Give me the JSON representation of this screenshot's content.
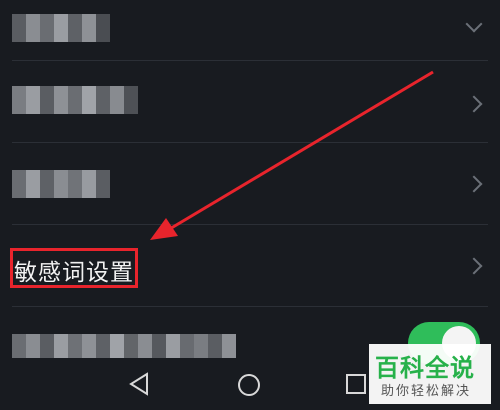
{
  "settings": {
    "highlighted_item_label": "敏感词设置",
    "toggle_on": true
  },
  "navigation": {
    "back_icon": "triangle-back-icon",
    "home_icon": "circle-home-icon",
    "recents_icon": "square-recents-icon"
  },
  "watermark": {
    "title": "百科全说",
    "subtitle": "助你轻松解决"
  },
  "colors": {
    "background": "#181b20",
    "highlight": "#e8242c",
    "toggle": "#2fbd5a",
    "watermark_green": "#27b14a"
  }
}
